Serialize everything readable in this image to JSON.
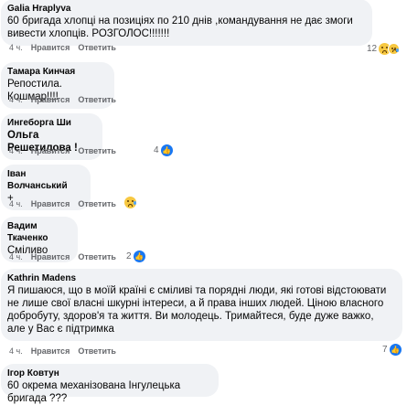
{
  "comments": [
    {
      "author": "Galia Hraplyva",
      "text": "60 бригада хлопці на позиціях по 210 днів ,командування не дає змоги вивести хлопців. РОЗГОЛОС!!!!!!!",
      "time": "4 ч.",
      "like_label": "Нравится",
      "reply_label": "Ответить",
      "reaction_count": "12",
      "reaction_icons": [
        "sad-icon",
        "like-icon"
      ]
    },
    {
      "author": "Тамара Кинчая",
      "text": "Репостила. Кошмар!!!!",
      "time": "4 ч.",
      "like_label": "Нравится",
      "reply_label": "Ответить"
    },
    {
      "author": "Ингеборга Ши",
      "text": "Ольга Решетилова !",
      "time": "4 ч.",
      "like_label": "Нравится",
      "reply_label": "Ответить",
      "reaction_count": "4",
      "reaction_icons": [
        "like-icon"
      ]
    },
    {
      "author": "Іван Волчанський",
      "text": "+",
      "time": "4 ч.",
      "like_label": "Нравится",
      "reply_label": "Ответить",
      "reaction_icons": [
        "sad-icon"
      ]
    },
    {
      "author": "Вадим Ткаченко",
      "text": "Сміливо",
      "time": "4 ч.",
      "like_label": "Нравится",
      "reply_label": "Ответить",
      "reaction_count": "2",
      "reaction_icons": [
        "like-icon"
      ]
    },
    {
      "author": "Kathrin Madens",
      "text": "Я пишаюся, що в моїй країні є сміливі та порядні люди, які готові відстоювати не лише свої власні шкурні інтереси, а й права інших людей. Ціною власного добробуту, здоров'я та життя. Ви молодець. Тримайтеся, буде дуже важко, але у Вас є підтримка",
      "time": "4 ч.",
      "like_label": "Нравится",
      "reply_label": "Ответить",
      "reaction_count": "7",
      "reaction_icons": [
        "like-icon"
      ]
    },
    {
      "author": "Ігор Ковтун",
      "text": "60 окрема механізована Інгулецька бригада ???"
    }
  ],
  "colors": {
    "bubble": "#f0f2f5",
    "meta": "#65676b",
    "like_blue": "#1877f2",
    "sad_yellow": "#f7c841"
  }
}
